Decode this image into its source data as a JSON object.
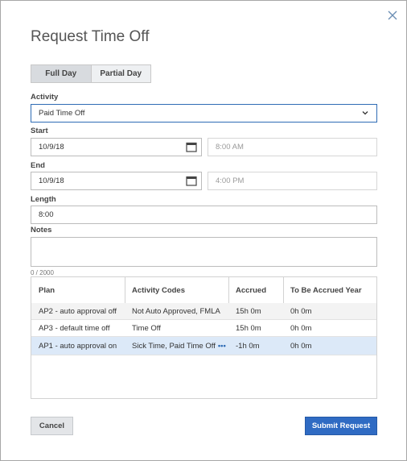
{
  "dialog": {
    "title": "Request Time Off",
    "close_icon": "close-icon",
    "colors": {
      "accent": "#2f6bc3",
      "close": "#6c8fb4",
      "selected_row": "#dce9f8"
    }
  },
  "mode_toggle": {
    "options": [
      "Full Day",
      "Partial Day"
    ],
    "selected": "Full Day"
  },
  "activity": {
    "label": "Activity",
    "value": "Paid Time Off"
  },
  "start": {
    "label": "Start",
    "date": "10/9/18",
    "time_placeholder": "8:00 AM"
  },
  "end": {
    "label": "End",
    "date": "10/9/18",
    "time_placeholder": "4:00 PM"
  },
  "length": {
    "label": "Length",
    "value": "8:00"
  },
  "notes": {
    "label": "Notes",
    "value": "",
    "counter": "0 / 2000"
  },
  "plans_table": {
    "columns": [
      "Plan",
      "Activity Codes",
      "Accrued",
      "To Be Accrued Year"
    ],
    "rows": [
      {
        "plan": "AP2 - auto approval off",
        "codes": "Not Auto Approved, FMLA",
        "accrued": "15h 0m",
        "to_be": "0h 0m",
        "more": ""
      },
      {
        "plan": "AP3 - default time off",
        "codes": "Time Off",
        "accrued": "15h 0m",
        "to_be": "0h 0m",
        "more": ""
      },
      {
        "plan": "AP1 - auto approval on",
        "codes": "Sick Time, Paid Time Off",
        "accrued": "-1h 0m",
        "to_be": "0h 0m",
        "more": "•••"
      }
    ],
    "selected_row": 2
  },
  "footer": {
    "cancel_label": "Cancel",
    "submit_label": "Submit Request"
  }
}
